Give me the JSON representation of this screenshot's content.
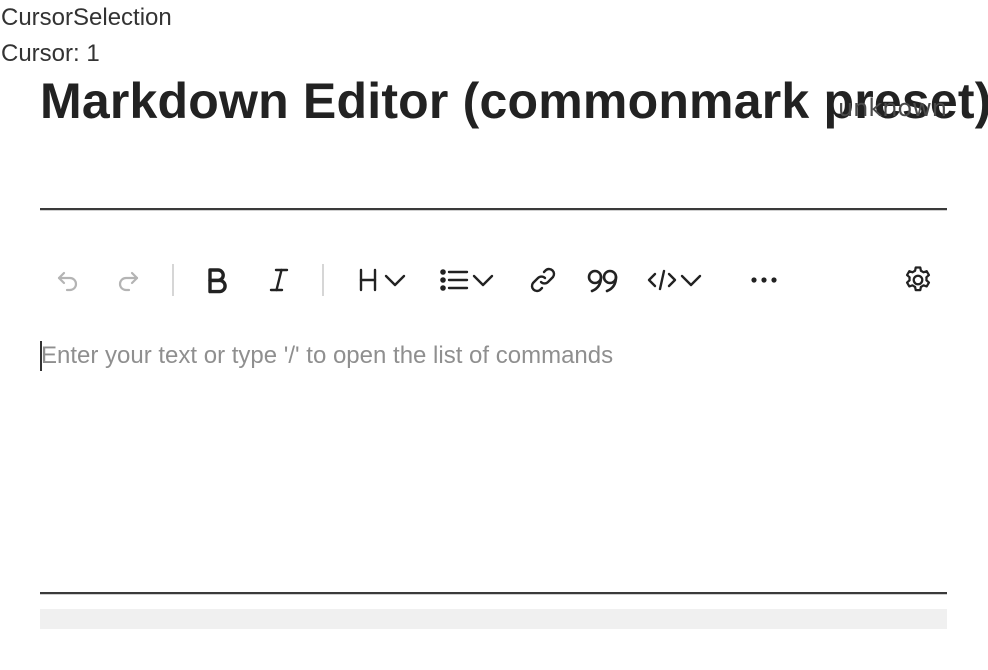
{
  "debug": {
    "title": "CursorSelection",
    "cursor": "Cursor: 1"
  },
  "editor": {
    "title": "Markdown Editor (commonmark preset)",
    "mode": "unknown",
    "placeholder": "Enter your text or type '/' to open the list of commands"
  },
  "toolbar": {
    "buttons": [
      {
        "name": "undo",
        "icon": "undo-icon",
        "enabled": false
      },
      {
        "name": "redo",
        "icon": "redo-icon",
        "enabled": false
      },
      {
        "name": "bold",
        "icon": "bold-icon",
        "enabled": true
      },
      {
        "name": "italic",
        "icon": "italic-icon",
        "enabled": true
      },
      {
        "name": "heading",
        "icon": "heading-icon",
        "dropdown": true
      },
      {
        "name": "list",
        "icon": "list-icon",
        "dropdown": true
      },
      {
        "name": "link",
        "icon": "link-icon"
      },
      {
        "name": "quote",
        "icon": "quote-icon"
      },
      {
        "name": "code",
        "icon": "code-icon",
        "dropdown": true
      },
      {
        "name": "more",
        "icon": "more-icon"
      },
      {
        "name": "settings",
        "icon": "gear-icon"
      }
    ]
  },
  "colors": {
    "text": "#222222",
    "disabled": "#b4b4b4",
    "placeholder": "#8f8f8f",
    "rule": "#3a3a3a",
    "status_bar": "#f0f0f0"
  }
}
